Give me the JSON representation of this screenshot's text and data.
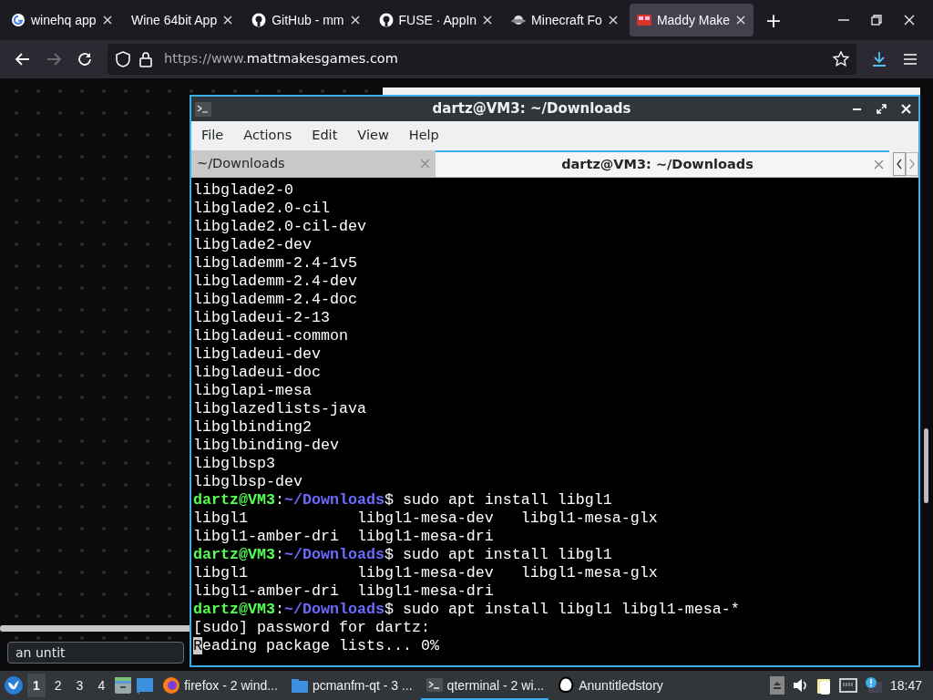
{
  "browser": {
    "tabs": [
      {
        "title": "winehq app",
        "kind": "google",
        "selected": false
      },
      {
        "title": "Wine 64bit App",
        "kind": "plain",
        "selected": false
      },
      {
        "title": "GitHub - mm",
        "kind": "github",
        "selected": false
      },
      {
        "title": "FUSE · AppIn",
        "kind": "github",
        "selected": false
      },
      {
        "title": "Minecraft Fo",
        "kind": "planet",
        "selected": false
      },
      {
        "title": "Maddy Make",
        "kind": "game",
        "selected": true
      }
    ],
    "new_tab": "+",
    "url": {
      "prefix": "https://www.",
      "host": "mattmakesgames.com"
    }
  },
  "page": {
    "input_value": "an untit"
  },
  "terminal": {
    "title": "dartz@VM3: ~/Downloads",
    "menu": [
      "File",
      "Actions",
      "Edit",
      "View",
      "Help"
    ],
    "tabs": [
      {
        "label": "~/Downloads",
        "selected": false
      },
      {
        "label": "dartz@VM3: ~/Downloads",
        "selected": true
      }
    ],
    "lines": [
      {
        "kind": "output",
        "text": "libglade2-0"
      },
      {
        "kind": "output",
        "text": "libglade2.0-cil"
      },
      {
        "kind": "output",
        "text": "libglade2.0-cil-dev"
      },
      {
        "kind": "output",
        "text": "libglade2-dev"
      },
      {
        "kind": "output",
        "text": "libglademm-2.4-1v5"
      },
      {
        "kind": "output",
        "text": "libglademm-2.4-dev"
      },
      {
        "kind": "output",
        "text": "libglademm-2.4-doc"
      },
      {
        "kind": "output",
        "text": "libgladeui-2-13"
      },
      {
        "kind": "output",
        "text": "libgladeui-common"
      },
      {
        "kind": "output",
        "text": "libgladeui-dev"
      },
      {
        "kind": "output",
        "text": "libgladeui-doc"
      },
      {
        "kind": "output",
        "text": "libglapi-mesa"
      },
      {
        "kind": "output",
        "text": "libglazedlists-java"
      },
      {
        "kind": "output",
        "text": "libglbinding2"
      },
      {
        "kind": "output",
        "text": "libglbinding-dev"
      },
      {
        "kind": "output",
        "text": "libglbsp3"
      },
      {
        "kind": "output",
        "text": "libglbsp-dev"
      },
      {
        "kind": "prompt",
        "user": "dartz@VM3",
        "sep": ":",
        "path": "~/Downloads",
        "command": "$ sudo apt install libgl1"
      },
      {
        "kind": "output",
        "text": "libgl1            libgl1-mesa-dev   libgl1-mesa-glx"
      },
      {
        "kind": "output",
        "text": "libgl1-amber-dri  libgl1-mesa-dri"
      },
      {
        "kind": "prompt",
        "user": "dartz@VM3",
        "sep": ":",
        "path": "~/Downloads",
        "command": "$ sudo apt install libgl1"
      },
      {
        "kind": "output",
        "text": "libgl1            libgl1-mesa-dev   libgl1-mesa-glx"
      },
      {
        "kind": "output",
        "text": "libgl1-amber-dri  libgl1-mesa-dri"
      },
      {
        "kind": "prompt",
        "user": "dartz@VM3",
        "sep": ":",
        "path": "~/Downloads",
        "command": "$ sudo apt install libgl1 libgl1-mesa-*"
      },
      {
        "kind": "output",
        "text": "[sudo] password for dartz:"
      },
      {
        "kind": "cursor",
        "cursor_text": "R",
        "text": "eading package lists... 0%"
      }
    ]
  },
  "taskbar": {
    "desktops": [
      {
        "label": "1",
        "selected": true
      },
      {
        "label": "2",
        "selected": false
      },
      {
        "label": "3",
        "selected": false
      },
      {
        "label": "4",
        "selected": false
      }
    ],
    "tasks": [
      {
        "label": "firefox - 2 wind...",
        "kind": "firefox",
        "selected": false
      },
      {
        "label": "pcmanfm-qt - 3 ...",
        "kind": "folder",
        "selected": false
      },
      {
        "label": "qterminal - 2 wi...",
        "kind": "terminal",
        "selected": true
      },
      {
        "label": "Anuntitledstory",
        "kind": "blob",
        "selected": false
      }
    ],
    "clock": "18:47"
  }
}
